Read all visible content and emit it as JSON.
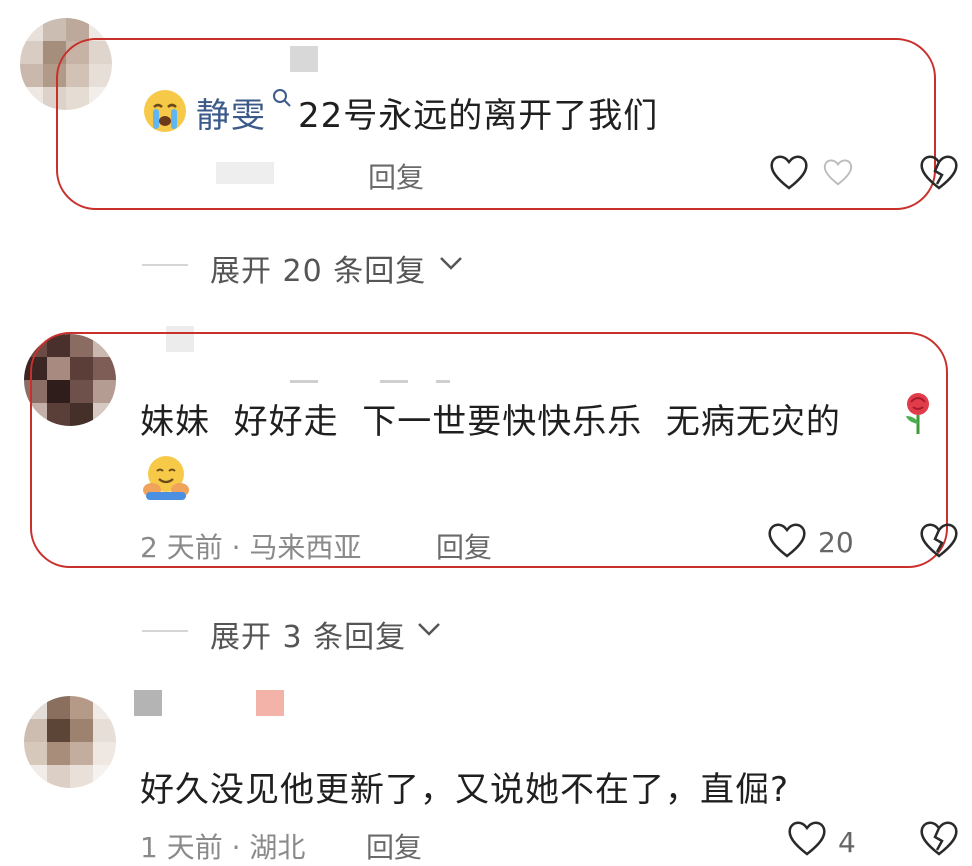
{
  "comments": [
    {
      "username": "静雯",
      "text": "22号永远的离开了我们",
      "reply_label": "回复"
    },
    {
      "expand_label": "展开 20 条回复"
    },
    {
      "text_line1": "妹妹  好好走  下一世要快快乐乐  无病无灾的",
      "meta": "2 天前 · 马来西亚",
      "reply_label": "回复",
      "like_count": "20"
    },
    {
      "expand_label": "展开 3 条回复"
    },
    {
      "text": "好久没见他更新了，又说她不在了，直倔?",
      "meta_partial": "1 天前 · 湖北",
      "reply_label": "回复",
      "like_count": "4"
    }
  ],
  "icons": {
    "like": "heart-outline-icon",
    "dislike": "broken-heart-icon",
    "crying": "crying-face-emoji",
    "rose": "rose-emoji",
    "hug": "hugging-face-emoji",
    "search": "search-icon"
  },
  "colors": {
    "highlight_border": "#c9302c",
    "username": "#3b5a8a"
  }
}
